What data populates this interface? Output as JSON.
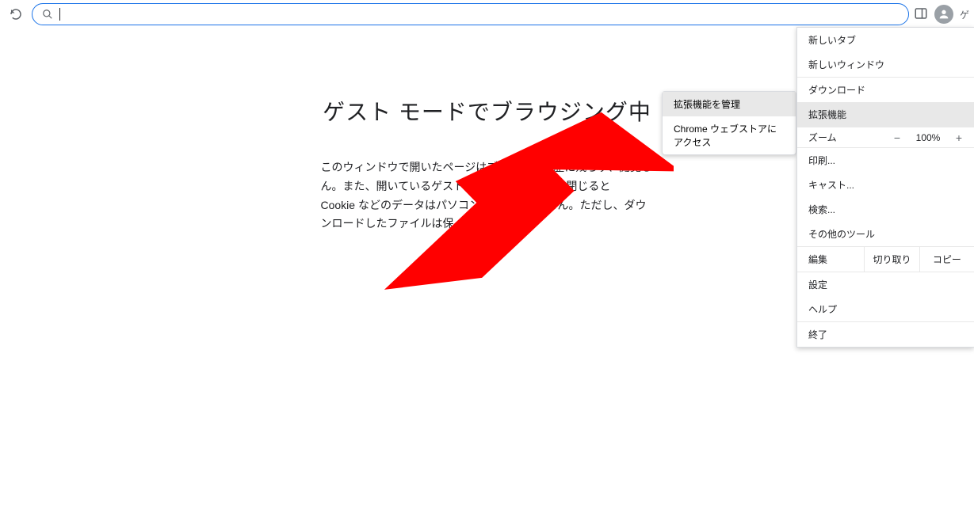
{
  "toolbar": {
    "guest_short": "ゲ"
  },
  "content": {
    "heading": "ゲスト モードでブラウジング中",
    "body_line1": "このウィンドウで開いたページはブラウザの履歴に残らず、閲覧し",
    "body_line2": "ん。また、開いているゲスト ウィンドウをすべて閉じると",
    "body_line3": "Cookie などのデータはパソコンに保存されません。ただし、ダウ",
    "body_line4": "ンロードしたファイルは保"
  },
  "menu": {
    "new_tab": "新しいタブ",
    "new_window": "新しいウィンドウ",
    "downloads": "ダウンロード",
    "extensions": "拡張機能",
    "zoom_label": "ズーム",
    "zoom_value": "100%",
    "print": "印刷...",
    "cast": "キャスト...",
    "find": "検索...",
    "more_tools": "その他のツール",
    "edit_label": "編集",
    "cut": "切り取り",
    "copy": "コピー",
    "settings": "設定",
    "help": "ヘルプ",
    "exit": "終了"
  },
  "submenu": {
    "manage_extensions": "拡張機能を管理",
    "web_store": "Chrome ウェブストアにアクセス"
  }
}
